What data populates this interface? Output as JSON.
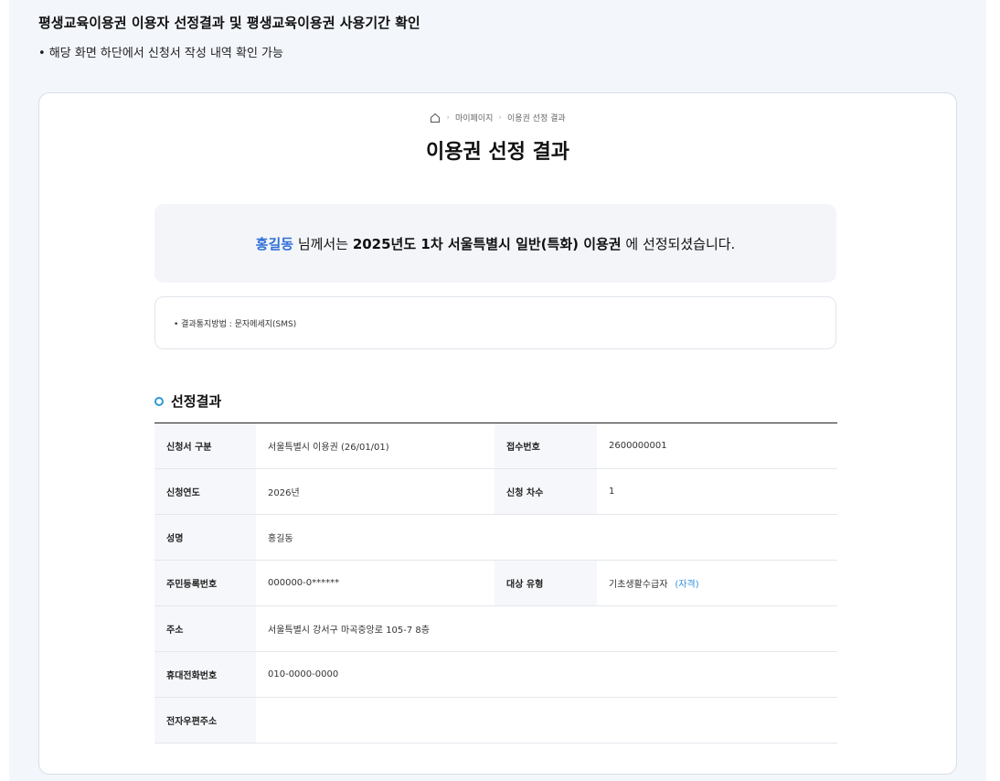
{
  "header": {
    "title": "평생교육이용권 이용자 선정결과 및 평생교육이용권 사용기간 확인",
    "note": "• 해당 화면 하단에서 신청서 작성 내역 확인 가능"
  },
  "breadcrumb": {
    "icon": "home-icon",
    "items": [
      "마이페이지",
      "이용권 선정 결과"
    ]
  },
  "page_title": "이용권 선정 결과",
  "banner": {
    "name": "홍길동",
    "middle": " 님께서는 ",
    "voucher": "2025년도 1차 서울특별시 일반(특화) 이용권",
    "suffix": " 에 선정되셨습니다."
  },
  "notice": "• 결과통지방법 : 문자메세지(SMS)",
  "section": {
    "title": "선정결과",
    "icon": "ring-bullet-icon"
  },
  "table": {
    "app_type_label": "신청서 구분",
    "app_type_value": "서울특별시 이용권 (26/01/01)",
    "receipt_label": "접수번호",
    "receipt_value": "2600000001",
    "year_label": "신청연도",
    "year_value": "2026년",
    "round_label": "신청 차수",
    "round_value": "1",
    "name_label": "성명",
    "name_value": "홍길동",
    "rrn_label": "주민등록번호",
    "rrn_value": "000000-0******",
    "target_label": "대상 유형",
    "target_value": "기초생활수급자",
    "target_link": "(자격)",
    "address_label": "주소",
    "address_value": "서울특별시 강서구 마곡중앙로 105-7 8층",
    "phone_label": "휴대전화번호",
    "phone_value": "010-0000-0000",
    "email_label": "전자우편주소",
    "email_value": ""
  },
  "colors": {
    "accent": "#2f6fd6",
    "link": "#2f8fe0",
    "ring": "#2f9bd6",
    "background": "#f3f6fb"
  }
}
